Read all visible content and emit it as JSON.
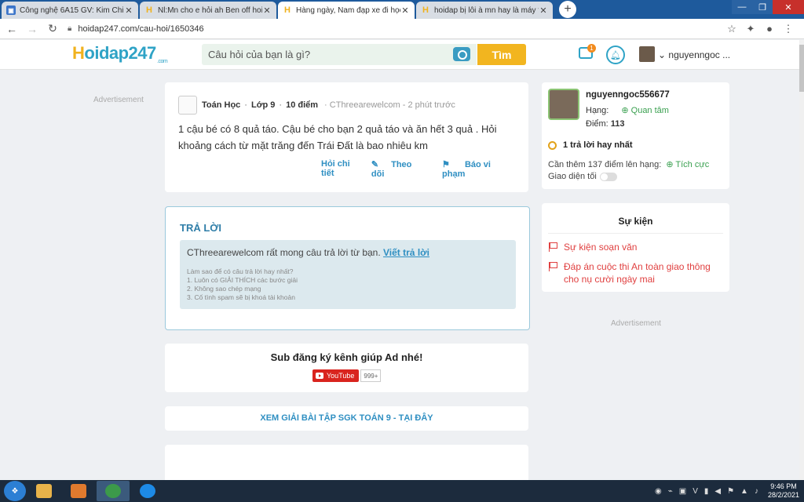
{
  "browser": {
    "tabs": [
      {
        "label": "Công nghệ 6A15 GV: Kim Chi",
        "icon": "classroom-icon",
        "color": "#3a74c9"
      },
      {
        "label": "Nl:Mn cho e hỏi ah Ben off hoidap",
        "icon": "hoidap-icon",
        "color": "#f0b21e"
      },
      {
        "label": "Hàng ngày, Nam đạp xe đi học v",
        "icon": "hoidap-icon",
        "color": "#f0b21e"
      },
      {
        "label": "hoidap bị lỗi à mn hay là máy tín",
        "icon": "hoidap-icon",
        "color": "#f0b21e"
      }
    ],
    "active_tab": 2,
    "url": "hoidap247.com/cau-hoi/1650346"
  },
  "header": {
    "logo_h": "H",
    "logo_rest": "oidap247",
    "logo_domain": ".com",
    "search_placeholder": "Câu hỏi của bạn là gì?",
    "search_button": "Tìm",
    "message_badge": "1",
    "username": "nguyenngoc ..."
  },
  "ads": {
    "left": "Advertisement",
    "right": "Advertisement"
  },
  "question": {
    "subject": "Toán Học",
    "grade": "Lớp 9",
    "points": "10 điểm",
    "author": "CThreearewelcom",
    "time": "2 phút trước",
    "text": "1 cậu bé có 8 quả táo. Cậu bé cho bạn 2 quả táo và ăn hết 3 quả . Hỏi khoảng cách từ mặt trăng đến Trái Đất là bao nhiêu km",
    "actions": {
      "detail": "Hỏi chi tiết",
      "follow": "Theo dõi",
      "report": "Báo vi phạm"
    }
  },
  "answer": {
    "title": "TRẢ LỜI",
    "invite_prefix": "CThreearewelcom rất mong câu trả lời từ bạn.",
    "invite_link": "Viết trả lời",
    "hint_title": "Làm sao để có câu trả lời hay nhất?",
    "hints": [
      "1. Luôn có GIẢI THÍCH các bước giải",
      "2. Không sao chép mạng",
      "3. Cố tình spam sẽ bị khoá tài khoản"
    ]
  },
  "subscribe": {
    "title": "Sub đăng ký kênh giúp Ad nhé!",
    "youtube_label": "YouTube",
    "count": "999+"
  },
  "sgk_link": "XEM GIẢI BÀI TẬP SGK TOÁN 9 - TẠI ĐÂY",
  "profile": {
    "name": "nguyenngoc556677",
    "rank_label": "Hạng:",
    "follow_label": "Quan tâm",
    "points_label": "Điểm:",
    "points": "113",
    "best_answers": "1 trả lời hay nhất",
    "need_points": "Cần thêm 137 điểm lên hạng:",
    "next_rank": "Tích cực",
    "dark_mode_label": "Giao diện tối",
    "dark_mode_on": false
  },
  "events": {
    "title": "Sự kiện",
    "items": [
      "Sự kiện soạn văn",
      "Đáp án cuộc thi An toàn giao thông cho nụ cười ngày mai"
    ]
  },
  "taskbar": {
    "time": "9:46 PM",
    "date": "28/2/2021",
    "lang": "V"
  }
}
